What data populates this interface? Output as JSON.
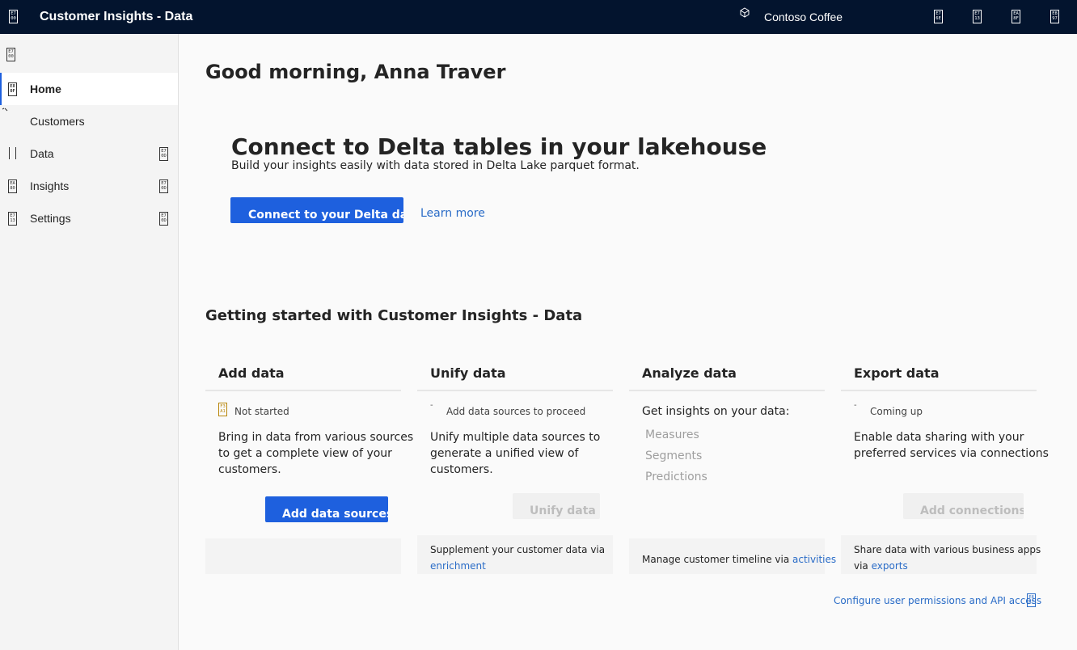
{
  "header": {
    "app_title": "Customer Insights - Data",
    "environment": "Contoso Coffee",
    "waffle_glyph": "E7 00",
    "buttons": [
      {
        "glyph": "E7 6E"
      },
      {
        "glyph": "E7 13"
      },
      {
        "glyph": "EA 8F"
      },
      {
        "glyph": "E8 97"
      }
    ]
  },
  "sidebar": {
    "collapse_glyph": "E7 00",
    "items": [
      {
        "label": "Home",
        "glyph": "E8 0F",
        "active": true
      },
      {
        "label": "Customers",
        "glyph": ""
      },
      {
        "label": "Data",
        "glyph": "",
        "expandable": true
      },
      {
        "label": "Insights",
        "glyph": "EA 80",
        "expandable": true
      },
      {
        "label": "Settings",
        "glyph": "E7 13",
        "expandable": true
      }
    ],
    "chevron_glyph": "E7 0D"
  },
  "main": {
    "greeting": "Good morning, Anna Traver",
    "hero": {
      "title": "Connect to Delta tables in your lakehouse",
      "subtitle": "Build your insights easily with data stored in Delta Lake parquet format.",
      "connect_label": "Connect to your Delta data",
      "learn_more": "Learn more"
    },
    "getting_started": "Getting started with Customer Insights - Data",
    "cards": {
      "add": {
        "title": "Add data",
        "status": "Not started",
        "status_glyph": "F3 A1",
        "description": "Bring in data from various sources to get a complete view of your customers.",
        "button": "Add data sources"
      },
      "unify": {
        "title": "Unify data",
        "status": "Add data sources to proceed",
        "description": "Unify multiple data sources to generate a unified view of customers.",
        "button": "Unify data",
        "footer_text": "Supplement your customer data via",
        "footer_link": "enrichment"
      },
      "analyze": {
        "title": "Analyze data",
        "intro": "Get insights on your data:",
        "items": [
          "Measures",
          "Segments",
          "Predictions"
        ],
        "footer_text": "Manage customer timeline via",
        "footer_link": "activities"
      },
      "export": {
        "title": "Export data",
        "status": "Coming up",
        "description": "Enable data sharing with your preferred services via connections",
        "button": "Add connections",
        "footer_text": "Share data with various business apps via",
        "footer_link": "exports"
      }
    },
    "config_link": "Configure user permissions and API access",
    "config_glyph": "E8 A7"
  }
}
